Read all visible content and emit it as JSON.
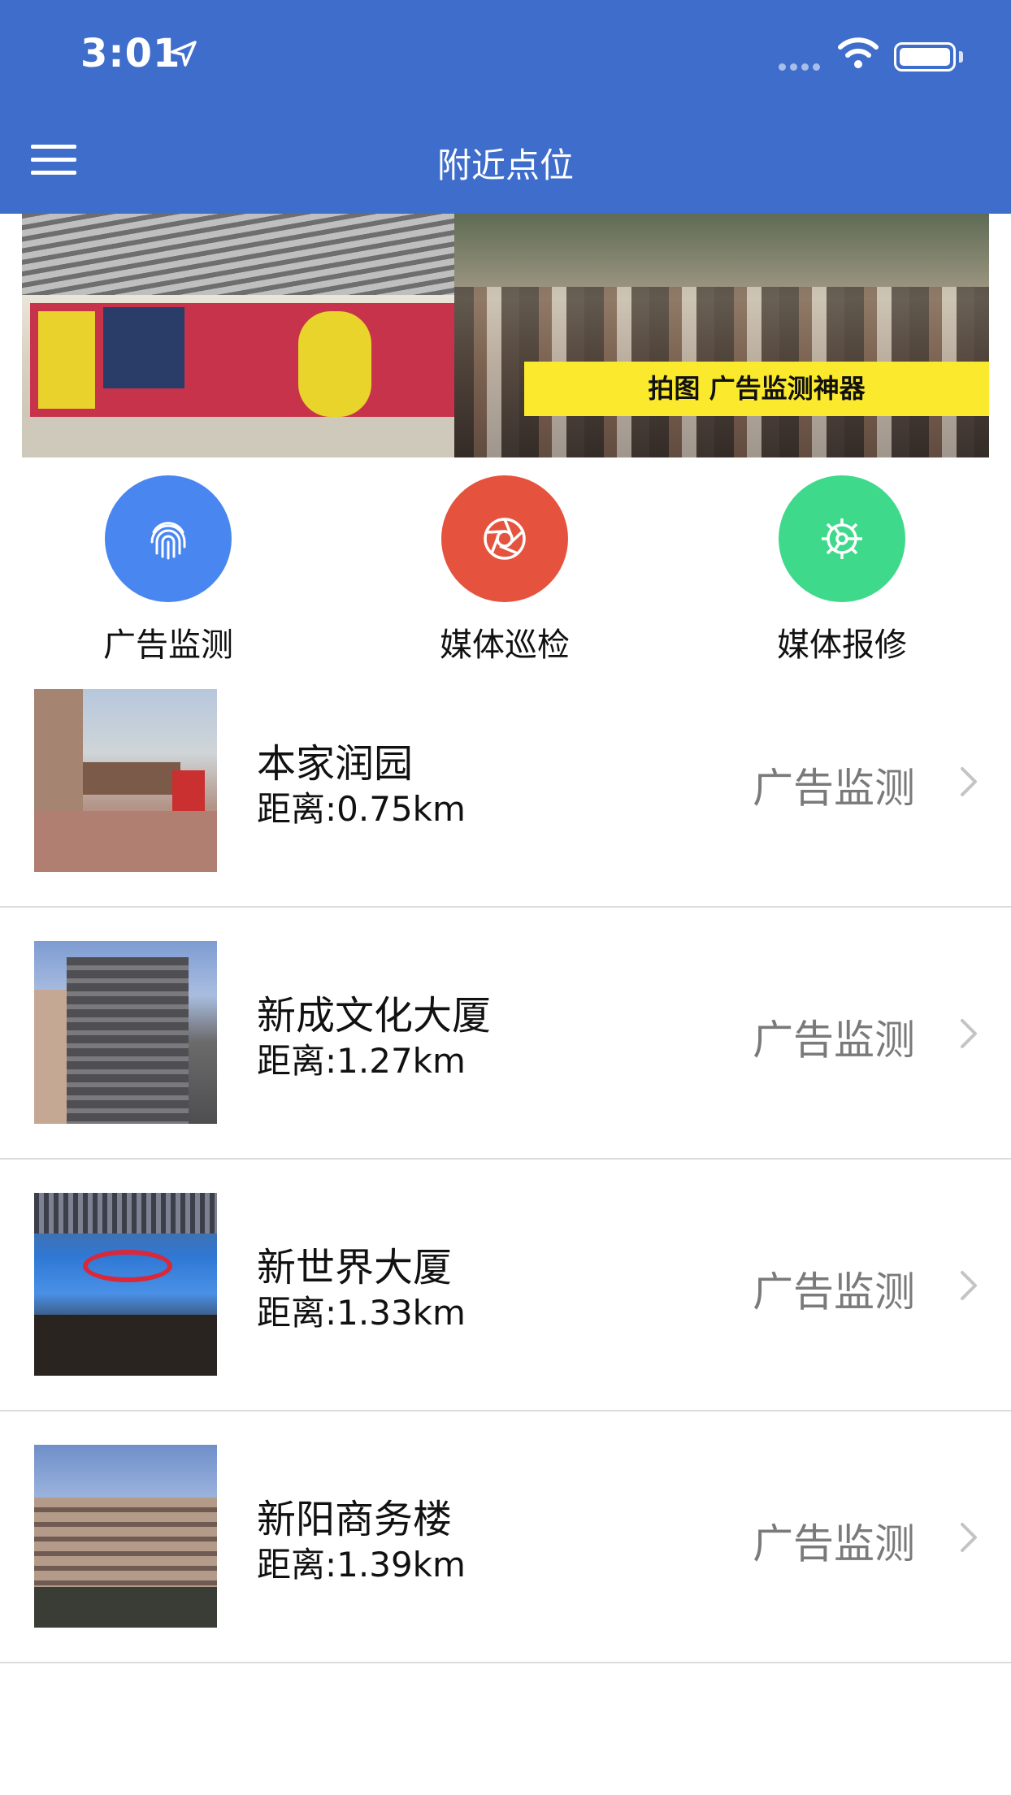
{
  "status_bar": {
    "time": "3:01"
  },
  "nav": {
    "title": "附近点位"
  },
  "banner": {
    "slogan": "拍图  广告监测神器"
  },
  "quick_actions": [
    {
      "label": "广告监测",
      "icon": "fingerprint-icon",
      "color": "#4a86f0"
    },
    {
      "label": "媒体巡检",
      "icon": "aperture-icon",
      "color": "#e5533e"
    },
    {
      "label": "媒体报修",
      "icon": "gear-icon",
      "color": "#3fd98b"
    }
  ],
  "locations": [
    {
      "name": "本家润园",
      "distance": "距离:0.75km",
      "action": "广告监测"
    },
    {
      "name": "新成文化大厦",
      "distance": "距离:1.27km",
      "action": "广告监测"
    },
    {
      "name": "新世界大厦",
      "distance": "距离:1.33km",
      "action": "广告监测"
    },
    {
      "name": "新阳商务楼",
      "distance": "距离:1.39km",
      "action": "广告监测"
    }
  ]
}
